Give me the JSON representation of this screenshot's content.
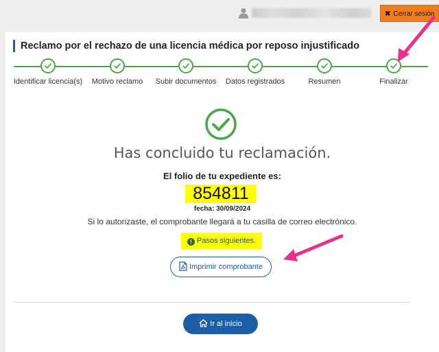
{
  "header": {
    "logout_label": "Cerrar sesión",
    "user_icon": "user-icon"
  },
  "page": {
    "title": "Reclamo por el rechazo de una licencia médica por reposo injustificado"
  },
  "stepper": {
    "steps": [
      {
        "label": "Identificar licencia(s)",
        "status": "done"
      },
      {
        "label": "Motivo reclamo",
        "status": "done"
      },
      {
        "label": "Subir documentos",
        "status": "done"
      },
      {
        "label": "Datos registrados",
        "status": "done"
      },
      {
        "label": "Resumen",
        "status": "done"
      },
      {
        "label": "Finalizar",
        "status": "done"
      }
    ]
  },
  "result": {
    "heading": "Has concluido tu reclamación.",
    "folio_label": "El folio de tu expediente es:",
    "folio_number": "854811",
    "date": "fecha: 30/09/2024",
    "notice": "Si lo autorizaste, el comprobante llegará a tu casilla de correo electrónico.",
    "next_steps_label": "Pasos siguientes."
  },
  "actions": {
    "print_label": "Imprimir comprobante",
    "home_label": "Ir al inicio"
  },
  "colors": {
    "accent": "#1c5fa8",
    "success": "#49a748",
    "logout": "#f07c1e",
    "highlight": "#ffff00",
    "annotation": "#e8308c"
  }
}
